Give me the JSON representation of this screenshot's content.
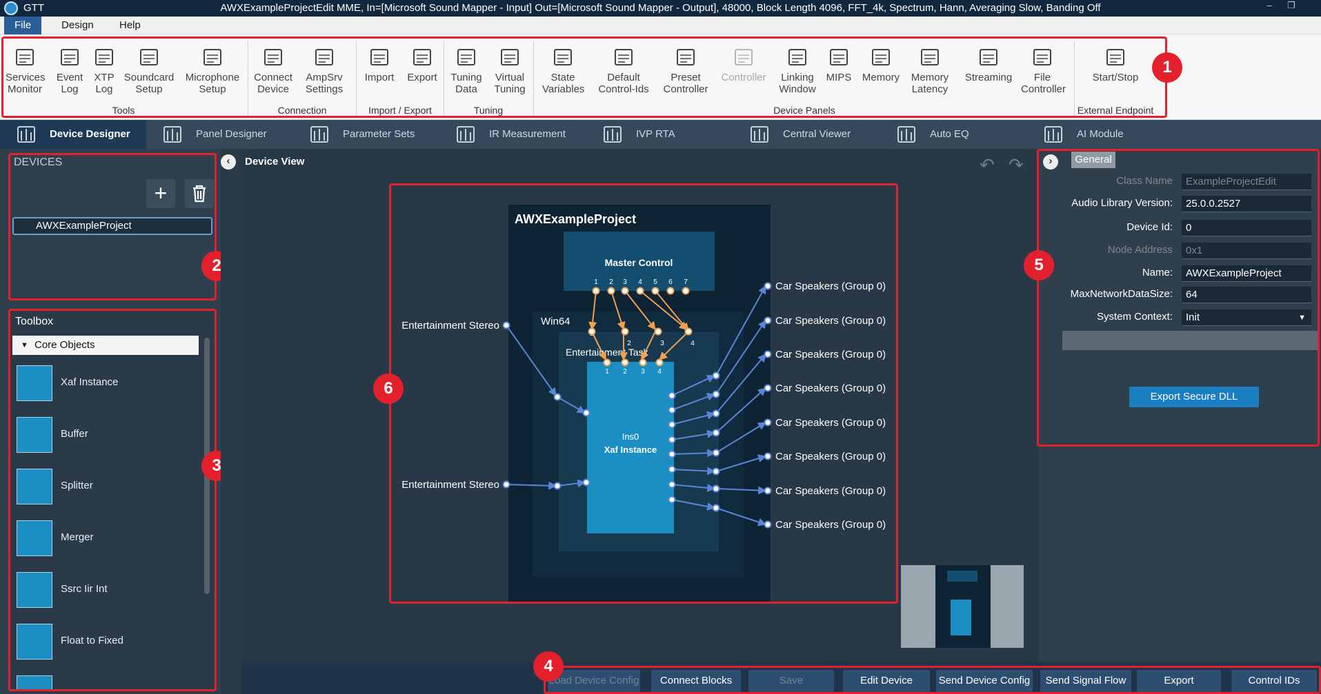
{
  "titlebar": {
    "app": "GTT",
    "title": "AWXExampleProjectEdit MME, In=[Microsoft Sound Mapper - Input] Out=[Microsoft Sound Mapper - Output], 48000, Block Length 4096, FFT_4k, Spectrum, Hann, Averaging Slow, Banding Off"
  },
  "menu": [
    "File",
    "Design",
    "Help"
  ],
  "ribbon": {
    "buttons": [
      {
        "l1": "Services",
        "l2": "Monitor"
      },
      {
        "l1": "Event",
        "l2": "Log"
      },
      {
        "l1": "XTP",
        "l2": "Log"
      },
      {
        "l1": "Soundcard",
        "l2": "Setup"
      },
      {
        "l1": "Microphone",
        "l2": "Setup"
      },
      {
        "l1": "Connect",
        "l2": "Device"
      },
      {
        "l1": "AmpSrv",
        "l2": "Settings"
      },
      {
        "l1": "Import",
        "l2": ""
      },
      {
        "l1": "Export",
        "l2": ""
      },
      {
        "l1": "Tuning",
        "l2": "Data"
      },
      {
        "l1": "Virtual",
        "l2": "Tuning"
      },
      {
        "l1": "State",
        "l2": "Variables"
      },
      {
        "l1": "Default",
        "l2": "Control-Ids"
      },
      {
        "l1": "Preset",
        "l2": "Controller"
      },
      {
        "l1": "Controller",
        "l2": ""
      },
      {
        "l1": "Linking",
        "l2": "Window"
      },
      {
        "l1": "MIPS",
        "l2": ""
      },
      {
        "l1": "Memory",
        "l2": ""
      },
      {
        "l1": "Memory",
        "l2": "Latency"
      },
      {
        "l1": "Streaming",
        "l2": ""
      },
      {
        "l1": "File",
        "l2": "Controller"
      },
      {
        "l1": "Start/Stop",
        "l2": ""
      }
    ],
    "groups": [
      "Tools",
      "Connection",
      "Import / Export",
      "Tuning",
      "Device Panels",
      "External Endpoint"
    ]
  },
  "badges": [
    "1",
    "2",
    "3",
    "4",
    "5",
    "6"
  ],
  "tabs": [
    "Device Designer",
    "Panel Designer",
    "Parameter Sets",
    "IR Measurement",
    "IVP RTA",
    "Central Viewer",
    "Auto EQ",
    "AI Module"
  ],
  "devices": {
    "heading": "DEVICES",
    "item": "AWXExampleProject",
    "add": "+"
  },
  "toolbox": {
    "heading": "Toolbox",
    "category": "Core Objects",
    "items": [
      "Xaf Instance",
      "Buffer",
      "Splitter",
      "Merger",
      "Ssrc Iir Int",
      "Float to Fixed"
    ]
  },
  "center": {
    "heading": "Device View",
    "project": "AWXExampleProject",
    "master": "Master Control",
    "master_pins": [
      "1",
      "2",
      "3",
      "4",
      "5",
      "6",
      "7"
    ],
    "win": "Win64",
    "task": "Entertainment Task",
    "task_pins": [
      "1",
      "2",
      "3",
      "4"
    ],
    "ins_pins": [
      "1",
      "2",
      "3",
      "4"
    ],
    "ins": "Ins0",
    "xaf": "Xaf Instance",
    "inputs": [
      "Entertainment Stereo",
      "Entertainment Stereo"
    ],
    "outputs": [
      "Car Speakers (Group 0)",
      "Car Speakers (Group 0)",
      "Car Speakers (Group 0)",
      "Car Speakers (Group 0)",
      "Car Speakers (Group 0)",
      "Car Speakers (Group 0)",
      "Car Speakers (Group 0)",
      "Car Speakers (Group 0)"
    ]
  },
  "properties": {
    "tab": "General",
    "rows": [
      {
        "label": "Class Name",
        "value": "ExampleProjectEdit",
        "dim": true
      },
      {
        "label": "Audio Library Version:",
        "value": "25.0.0.2527",
        "dim": false
      },
      {
        "label": "Device Id:",
        "value": "0",
        "dim": false
      },
      {
        "label": "Node Address",
        "value": "0x1",
        "dim": true
      },
      {
        "label": "Name:",
        "value": "AWXExampleProject",
        "dim": false
      },
      {
        "label": "MaxNetworkDataSize:",
        "value": "64",
        "dim": false
      },
      {
        "label": "System Context:",
        "value": "Init",
        "dim": false
      }
    ],
    "export_button": "Export Secure DLL"
  },
  "bottom": [
    "Load Device Config",
    "Connect Blocks",
    "Save",
    "Edit Device",
    "Send Device Config",
    "Send Signal Flow",
    "Export",
    "Control IDs"
  ],
  "colors": {
    "accent": "#e3202b",
    "xaf": "#1b8fc4",
    "wire": "#5b86d8",
    "master_wire": "#f0a050"
  }
}
